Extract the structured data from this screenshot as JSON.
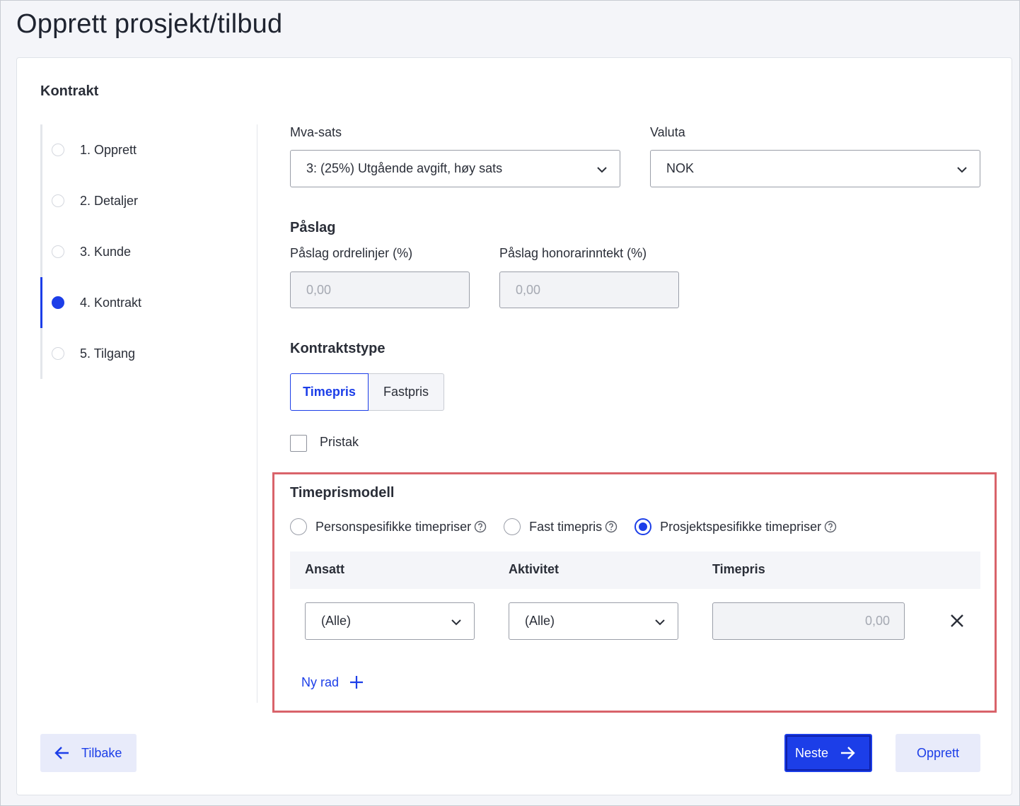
{
  "page": {
    "title": "Opprett prosjekt/tilbud"
  },
  "section": {
    "title": "Kontrakt"
  },
  "steps": [
    {
      "label": "1. Opprett",
      "active": false
    },
    {
      "label": "2. Detaljer",
      "active": false
    },
    {
      "label": "3. Kunde",
      "active": false
    },
    {
      "label": "4. Kontrakt",
      "active": true
    },
    {
      "label": "5. Tilgang",
      "active": false
    }
  ],
  "vat": {
    "label": "Mva-sats",
    "value": "3: (25%) Utgående avgift, høy sats"
  },
  "currency": {
    "label": "Valuta",
    "value": "NOK"
  },
  "markup": {
    "title": "Påslag",
    "orderlines_label": "Påslag ordrelinjer (%)",
    "orderlines_placeholder": "0,00",
    "fee_label": "Påslag honorarinntekt (%)",
    "fee_placeholder": "0,00"
  },
  "contract_type": {
    "title": "Kontraktstype",
    "options": [
      "Timepris",
      "Fastpris"
    ],
    "selected": "Timepris"
  },
  "price_cap": {
    "label": "Pristak",
    "checked": false
  },
  "hourly_model": {
    "title": "Timeprismodell",
    "options": [
      {
        "label": "Personspesifikke timepriser",
        "selected": false
      },
      {
        "label": "Fast timepris",
        "selected": false
      },
      {
        "label": "Prosjektspesifikke timepriser",
        "selected": true
      }
    ],
    "table": {
      "headers": [
        "Ansatt",
        "Aktivitet",
        "Timepris"
      ],
      "rows": [
        {
          "employee": "(Alle)",
          "activity": "(Alle)",
          "rate_placeholder": "0,00"
        }
      ]
    },
    "new_row_label": "Ny rad"
  },
  "buttons": {
    "back": "Tilbake",
    "next": "Neste",
    "create": "Opprett"
  },
  "colors": {
    "accent": "#1c3ee8",
    "highlight": "#d9636a"
  }
}
